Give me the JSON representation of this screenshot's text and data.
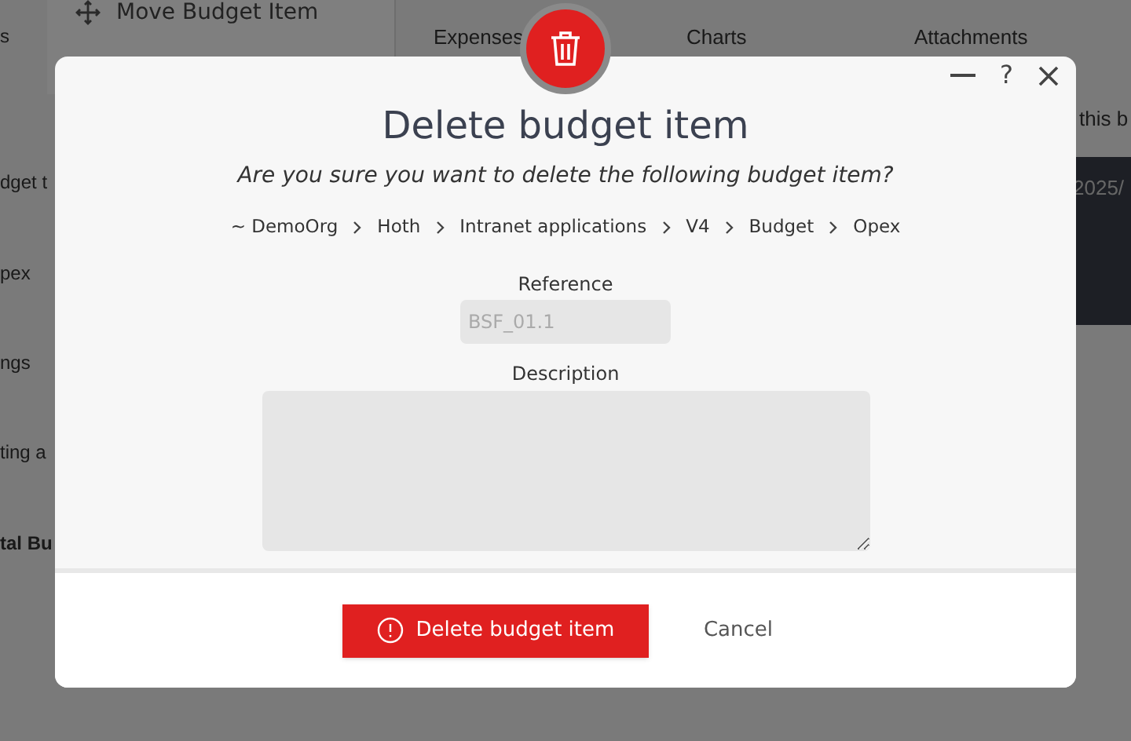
{
  "background": {
    "menu_item": "Move Budget Item",
    "tabs": [
      "Expenses",
      "Charts",
      "Attachments"
    ],
    "left_texts": [
      "s",
      "dget t",
      "pex",
      "ngs",
      "ting a",
      "tal Bu"
    ],
    "right_texts": [
      "this b",
      "2025/"
    ]
  },
  "dialog": {
    "title": "Delete budget item",
    "help": "?",
    "question": "Are you sure you want to delete the following budget item?",
    "breadcrumb": [
      "~ DemoOrg",
      "Hoth",
      "Intranet applications",
      "V4",
      "Budget",
      "Opex"
    ],
    "fields": [
      {
        "kind": "input",
        "label": "Reference",
        "value": "BSF_01.1",
        "disabled": true
      },
      {
        "kind": "textarea",
        "label": "Description",
        "disabled": true
      }
    ],
    "buttons": [
      {
        "kind": "primary",
        "label": "Delete budget item"
      },
      {
        "kind": "link",
        "label": "Cancel"
      }
    ]
  }
}
